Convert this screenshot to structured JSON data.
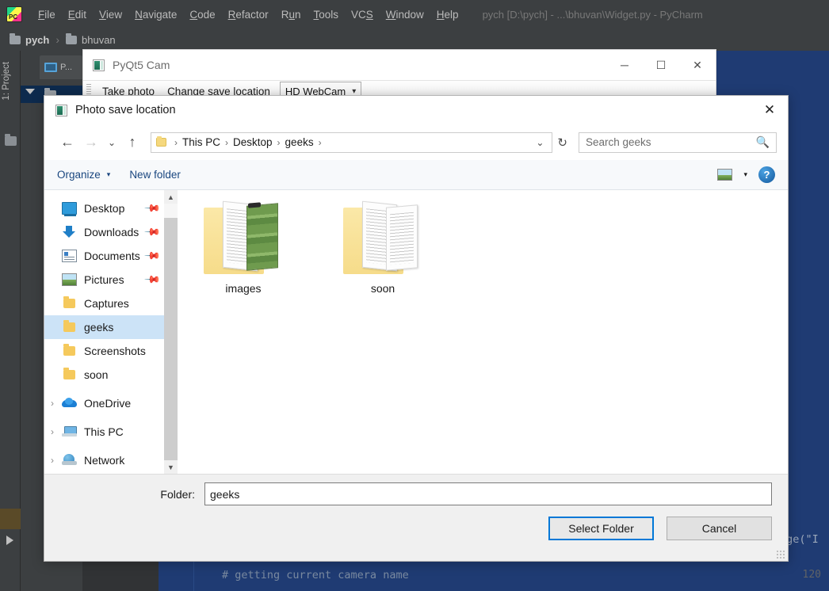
{
  "ide": {
    "logo_icon": "pycharm-logo-icon",
    "menu": [
      {
        "label": "File",
        "mnemonic": "F"
      },
      {
        "label": "Edit",
        "mnemonic": "E"
      },
      {
        "label": "View",
        "mnemonic": "V"
      },
      {
        "label": "Navigate",
        "mnemonic": "N"
      },
      {
        "label": "Code",
        "mnemonic": "C"
      },
      {
        "label": "Refactor",
        "mnemonic": "R"
      },
      {
        "label": "Run",
        "mnemonic": "R"
      },
      {
        "label": "Tools",
        "mnemonic": "T"
      },
      {
        "label": "VCS",
        "mnemonic": "S"
      },
      {
        "label": "Window",
        "mnemonic": "W"
      },
      {
        "label": "Help",
        "mnemonic": "H"
      }
    ],
    "window_title": "pych [D:\\pych] - ...\\bhuvan\\Widget.py - PyCharm",
    "breadcrumb": [
      "pych",
      "bhuvan"
    ],
    "tool_strip_label": "1: Project",
    "project_tab_label": "P...",
    "editor": {
      "line_number": "120",
      "comment_line": "# getting current camera name",
      "fragment_parens": ")))",
      "fragment_right": "age(\"I",
      "background_color": "#1f3b73",
      "gutter_color": "#313335"
    }
  },
  "cam_window": {
    "icon": "app-icon",
    "title": "PyQt5 Cam",
    "controls": {
      "minimize": "─",
      "maximize": "☐",
      "close": "✕"
    },
    "toolbar": {
      "take_photo": "Take photo",
      "change_save_location": "Change save location",
      "camera_combo_value": "HD WebCam"
    }
  },
  "dialog": {
    "icon": "app-icon",
    "title": "Photo save location",
    "close_label": "✕",
    "nav": {
      "back": "←",
      "forward": "→",
      "recent": "⌄",
      "up": "↑",
      "breadcrumb": [
        "This PC",
        "Desktop",
        "geeks"
      ],
      "address_chevron": "⌄",
      "refresh": "↻"
    },
    "search": {
      "placeholder": "Search geeks",
      "icon": "search-icon"
    },
    "toolbar": {
      "organize": "Organize",
      "organize_caret": "▾",
      "new_folder": "New folder",
      "view_caret": "▾",
      "help": "?"
    },
    "sidebar": {
      "items": [
        {
          "label": "Desktop",
          "icon": "desktop-icon",
          "pinned": true,
          "expandable": false,
          "selected": false
        },
        {
          "label": "Downloads",
          "icon": "download-icon",
          "pinned": true,
          "expandable": false,
          "selected": false
        },
        {
          "label": "Documents",
          "icon": "document-icon",
          "pinned": true,
          "expandable": false,
          "selected": false
        },
        {
          "label": "Pictures",
          "icon": "pictures-icon",
          "pinned": true,
          "expandable": false,
          "selected": false
        },
        {
          "label": "Captures",
          "icon": "folder-icon",
          "pinned": false,
          "expandable": false,
          "selected": false
        },
        {
          "label": "geeks",
          "icon": "folder-icon",
          "pinned": false,
          "expandable": false,
          "selected": true
        },
        {
          "label": "Screenshots",
          "icon": "folder-icon",
          "pinned": false,
          "expandable": false,
          "selected": false
        },
        {
          "label": "soon",
          "icon": "folder-icon",
          "pinned": false,
          "expandable": false,
          "selected": false
        },
        {
          "label": "OneDrive",
          "icon": "onedrive-icon",
          "pinned": false,
          "expandable": true,
          "selected": false
        },
        {
          "label": "This PC",
          "icon": "this-pc-icon",
          "pinned": false,
          "expandable": true,
          "selected": false
        },
        {
          "label": "Network",
          "icon": "network-icon",
          "pinned": false,
          "expandable": true,
          "selected": false
        }
      ],
      "pin_glyph": "⎘",
      "chevron_glyph": "›"
    },
    "files": [
      {
        "name": "images",
        "type": "folder-with-pictures"
      },
      {
        "name": "soon",
        "type": "folder-with-documents"
      }
    ],
    "footer": {
      "folder_label": "Folder:",
      "folder_value": "geeks",
      "select_button": "Select Folder",
      "cancel_button": "Cancel",
      "accent_color": "#0078d7"
    }
  }
}
